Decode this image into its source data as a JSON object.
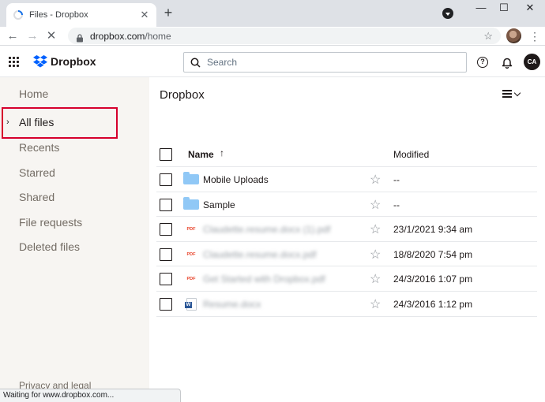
{
  "browser": {
    "tab_title": "Files - Dropbox",
    "url_host": "dropbox.com",
    "url_path": "/home",
    "status_text": "Waiting for www.dropbox.com..."
  },
  "app": {
    "brand": "Dropbox",
    "search_placeholder": "Search",
    "user_initials": "CA",
    "brand_color": "#0061fe"
  },
  "sidebar": {
    "items": [
      {
        "label": "Home"
      },
      {
        "label": "All files"
      },
      {
        "label": "Recents"
      },
      {
        "label": "Starred"
      },
      {
        "label": "Shared"
      },
      {
        "label": "File requests"
      },
      {
        "label": "Deleted files"
      }
    ],
    "footer": "Privacy and legal",
    "highlight_color": "#d6002c"
  },
  "main": {
    "title": "Dropbox",
    "columns": {
      "name": "Name",
      "sort_arrow": "↑",
      "modified": "Modified"
    },
    "rows": [
      {
        "name": "Mobile Uploads",
        "type": "folder",
        "modified": "--"
      },
      {
        "name": "Sample",
        "type": "folder",
        "modified": "--"
      },
      {
        "name": "Claudette.resume.docx (1).pdf",
        "type": "pdf",
        "icon_label": "PDF",
        "modified": "23/1/2021 9:34 am"
      },
      {
        "name": "Claudette.resume.docx.pdf",
        "type": "pdf",
        "icon_label": "PDF",
        "modified": "18/8/2020 7:54 pm"
      },
      {
        "name": "Get Started with Dropbox.pdf",
        "type": "pdf",
        "icon_label": "PDF",
        "modified": "24/3/2016 1:07 pm"
      },
      {
        "name": "Resume.docx",
        "type": "docx",
        "icon_label": "W",
        "modified": "24/3/2016 1:12 pm"
      }
    ]
  }
}
